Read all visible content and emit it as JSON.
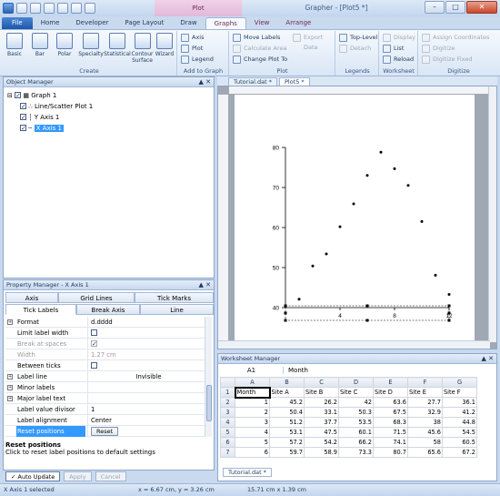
{
  "window": {
    "title": "Grapher - [Plot5 *]",
    "context_tab_group": "Plot",
    "buttons": {
      "minimize": "–",
      "maximize": "□",
      "close": "✕"
    }
  },
  "ribbon_tabs": [
    "File",
    "Home",
    "Developer",
    "Page Layout",
    "Draw",
    "Graphs",
    "View",
    "Arrange"
  ],
  "active_tab": "Graphs",
  "ribbon": {
    "create": {
      "label": "Create",
      "buttons": [
        "Basic",
        "Bar",
        "Polar",
        "Specialty",
        "Statistical",
        "Contour Surface",
        "Wizard"
      ]
    },
    "add_to_graph": {
      "label": "Add to Graph",
      "buttons": [
        "Axis",
        "Plot",
        "Legend"
      ]
    },
    "plot": {
      "label": "Plot",
      "buttons": [
        "Move Labels",
        "Calculate Area",
        "Change Plot To",
        "Export Data"
      ]
    },
    "legends": {
      "label": "Legends",
      "buttons": [
        "Top-Level",
        "Detach"
      ]
    },
    "worksheet": {
      "label": "Worksheet",
      "buttons": [
        "Display",
        "List",
        "Reload"
      ]
    },
    "digitize": {
      "label": "Digitize",
      "buttons": [
        "Assign Coordinates",
        "Digitize",
        "Digitize Fixed"
      ]
    }
  },
  "object_manager": {
    "title": "Object Manager",
    "pin": "▲ ✕",
    "items": [
      {
        "label": "Graph 1"
      },
      {
        "label": "Line/Scatter Plot 1"
      },
      {
        "label": "Y Axis 1"
      },
      {
        "label": "X Axis 1"
      }
    ]
  },
  "property_manager": {
    "title": "Property Manager - X Axis 1",
    "tabs": [
      "Axis",
      "Grid Lines",
      "Tick Marks",
      "Tick Labels",
      "Break Axis",
      "Line"
    ],
    "rows": [
      {
        "key": "Format",
        "value": "d.dddd"
      },
      {
        "key": "Limit label width",
        "value": ""
      },
      {
        "key": "Break at spaces",
        "value": ""
      },
      {
        "key": "Width",
        "value": "1.27 cm"
      },
      {
        "key": "Between ticks",
        "value": ""
      },
      {
        "key": "Label line",
        "value": "Invisible"
      },
      {
        "key": "Minor labels",
        "value": ""
      },
      {
        "key": "Major label text",
        "value": ""
      },
      {
        "key": "Label value divisor",
        "value": "1"
      },
      {
        "key": "Label alignment",
        "value": "Center"
      },
      {
        "key": "Reset positions",
        "value": "Reset"
      }
    ],
    "description_title": "Reset positions",
    "description_text": "Click to reset label positions to default settings",
    "bottom_buttons": [
      "Auto Update",
      "Apply",
      "Cancel"
    ]
  },
  "doc_tabs": [
    "Tutorial.dat *",
    "Plot5 *"
  ],
  "chart_data": {
    "type": "scatter",
    "title": "",
    "xlabel": "",
    "ylabel": "",
    "xlim": [
      0,
      12
    ],
    "ylim": [
      40,
      80
    ],
    "x_ticks": [
      "4",
      "8",
      "12"
    ],
    "y_ticks": [
      "40",
      "50",
      "60",
      "70",
      "80"
    ],
    "series": [
      {
        "x": [
          1,
          2,
          3,
          4,
          5,
          6,
          7,
          8,
          9,
          10,
          11,
          12
        ],
        "y": [
          42.1,
          50.4,
          53.4,
          60.2,
          65.9,
          73.0,
          78.8,
          74.7,
          70.5,
          61.5,
          48.1,
          43.3
        ]
      }
    ],
    "point_color": "#000000"
  },
  "worksheet_manager": {
    "title": "Worksheet Manager",
    "cell_ref": "A1",
    "cell_value": "Month",
    "columns": [
      "A",
      "B",
      "C",
      "D",
      "E",
      "F",
      "G"
    ],
    "rows": [
      {
        "n": "1",
        "cells": [
          "Month",
          "Site A",
          "Site B",
          "Site C",
          "Site D",
          "Site E",
          "Site F"
        ]
      },
      {
        "n": "2",
        "cells": [
          "1",
          "45.2",
          "26.2",
          "42",
          "63.6",
          "27.7",
          "36.1"
        ]
      },
      {
        "n": "3",
        "cells": [
          "2",
          "50.4",
          "33.1",
          "50.3",
          "67.5",
          "32.9",
          "41.2"
        ]
      },
      {
        "n": "4",
        "cells": [
          "3",
          "51.2",
          "37.7",
          "53.5",
          "68.3",
          "38",
          "44.8"
        ]
      },
      {
        "n": "5",
        "cells": [
          "4",
          "53.1",
          "47.5",
          "60.1",
          "71.5",
          "45.6",
          "54.5"
        ]
      },
      {
        "n": "6",
        "cells": [
          "5",
          "57.2",
          "54.2",
          "66.2",
          "74.1",
          "58",
          "60.5"
        ]
      },
      {
        "n": "7",
        "cells": [
          "6",
          "59.7",
          "58.9",
          "73.3",
          "80.7",
          "65.6",
          "67.2"
        ]
      }
    ],
    "sheet_tab": "Tutorial.dat *"
  },
  "status_bar": {
    "selection": "X Axis 1 selected",
    "coords": "x = 6.67 cm, y = 3.26 cm",
    "size": "15.71 cm x 1.39 cm"
  }
}
